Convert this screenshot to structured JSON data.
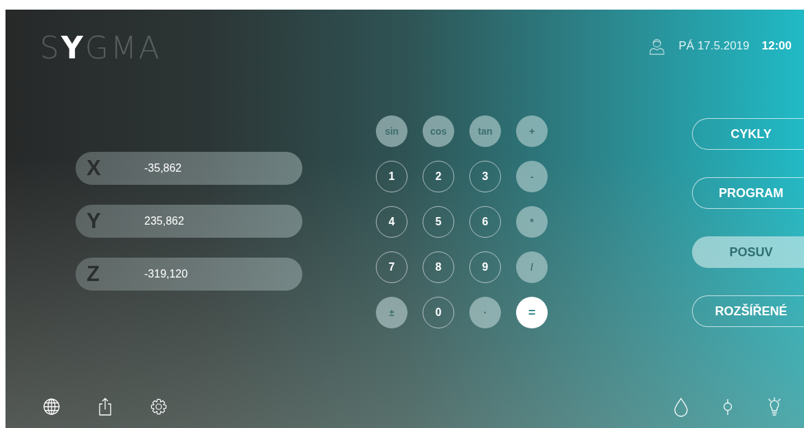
{
  "logo": "S**Y**GMA",
  "header": {
    "date": "PÁ 17.5.2019",
    "time": "12:00"
  },
  "axes": [
    {
      "label": "X",
      "value": "-35,862"
    },
    {
      "label": "Y",
      "value": "235,862"
    },
    {
      "label": "Z",
      "value": "-319,120"
    }
  ],
  "keypad": [
    {
      "label": "sin",
      "kind": "function"
    },
    {
      "label": "cos",
      "kind": "function"
    },
    {
      "label": "tan",
      "kind": "function"
    },
    {
      "label": "+",
      "kind": "function"
    },
    {
      "label": "1",
      "kind": "digit"
    },
    {
      "label": "2",
      "kind": "digit"
    },
    {
      "label": "3",
      "kind": "digit"
    },
    {
      "label": "-",
      "kind": "function"
    },
    {
      "label": "4",
      "kind": "digit"
    },
    {
      "label": "5",
      "kind": "digit"
    },
    {
      "label": "6",
      "kind": "digit"
    },
    {
      "label": "*",
      "kind": "function"
    },
    {
      "label": "7",
      "kind": "digit"
    },
    {
      "label": "8",
      "kind": "digit"
    },
    {
      "label": "9",
      "kind": "digit"
    },
    {
      "label": "/",
      "kind": "function"
    },
    {
      "label": "±",
      "kind": "function"
    },
    {
      "label": "0",
      "kind": "digit"
    },
    {
      "label": "·",
      "kind": "function"
    },
    {
      "label": "=",
      "kind": "primary"
    }
  ],
  "menu": [
    {
      "label": "CYKLY",
      "selected": false
    },
    {
      "label": "PROGRAM",
      "selected": false
    },
    {
      "label": "POSUV",
      "selected": true
    },
    {
      "label": "ROZŠÍŘENÉ",
      "selected": false
    }
  ]
}
